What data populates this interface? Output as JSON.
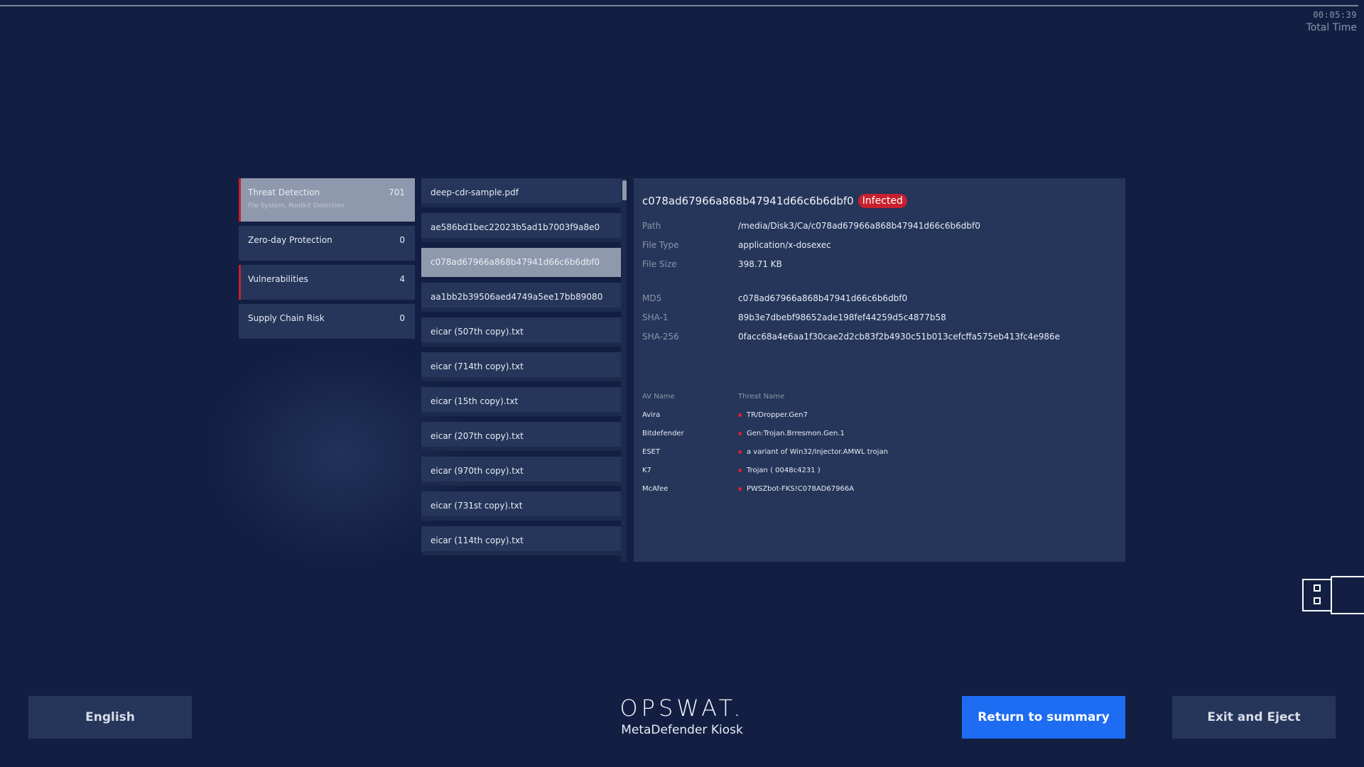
{
  "timer": {
    "time": "00:05:39",
    "label": "Total Time"
  },
  "categories": [
    {
      "name": "Threat Detection",
      "count": "701",
      "sub": "File System, Rootkit Detection"
    },
    {
      "name": "Zero-day Protection",
      "count": "0"
    },
    {
      "name": "Vulnerabilities",
      "count": "4"
    },
    {
      "name": "Supply Chain Risk",
      "count": "0"
    }
  ],
  "files": [
    "deep-cdr-sample.pdf",
    "ae586bd1bec22023b5ad1b7003f9a8e0",
    "c078ad67966a868b47941d66c6b6dbf0",
    "aa1bb2b39506aed4749a5ee17bb89080",
    "eicar (507th copy).txt",
    "eicar (714th copy).txt",
    "eicar (15th copy).txt",
    "eicar (207th copy).txt",
    "eicar (970th copy).txt",
    "eicar (731st copy).txt",
    "eicar (114th copy).txt"
  ],
  "detail": {
    "title": "c078ad67966a868b47941d66c6b6dbf0",
    "badge": "Infected",
    "path_label": "Path",
    "path": "/media/Disk3/Ca/c078ad67966a868b47941d66c6b6dbf0",
    "type_label": "File Type",
    "type": "application/x-dosexec",
    "size_label": "File Size",
    "size": "398.71 KB",
    "md5_label": "MD5",
    "md5": "c078ad67966a868b47941d66c6b6dbf0",
    "sha1_label": "SHA-1",
    "sha1": "89b3e7dbebf98652ade198fef44259d5c4877b58",
    "sha256_label": "SHA-256",
    "sha256": "0facc68a4e6aa1f30cae2d2cb83f2b4930c51b013cefcffa575eb413fc4e986e",
    "av_header": "AV Name",
    "threat_header": "Threat Name",
    "av": [
      {
        "name": "Avira",
        "threat": "TR/Dropper.Gen7"
      },
      {
        "name": "Bitdefender",
        "threat": "Gen:Trojan.Brresmon.Gen.1"
      },
      {
        "name": "ESET",
        "threat": "a variant of Win32/Injector.AMWL trojan"
      },
      {
        "name": "K7",
        "threat": "Trojan ( 0048c4231 )"
      },
      {
        "name": "McAfee",
        "threat": "PWSZbot-FKS!C078AD67966A"
      }
    ]
  },
  "footer": {
    "language": "English",
    "brand": "OPSWAT.",
    "product": "MetaDefender Kiosk",
    "return": "Return to summary",
    "exit": "Exit and Eject"
  },
  "colors": {
    "accent": "#1d6cf2",
    "infected": "#c8202e",
    "background": "#121f42",
    "panel": "#25365a"
  }
}
